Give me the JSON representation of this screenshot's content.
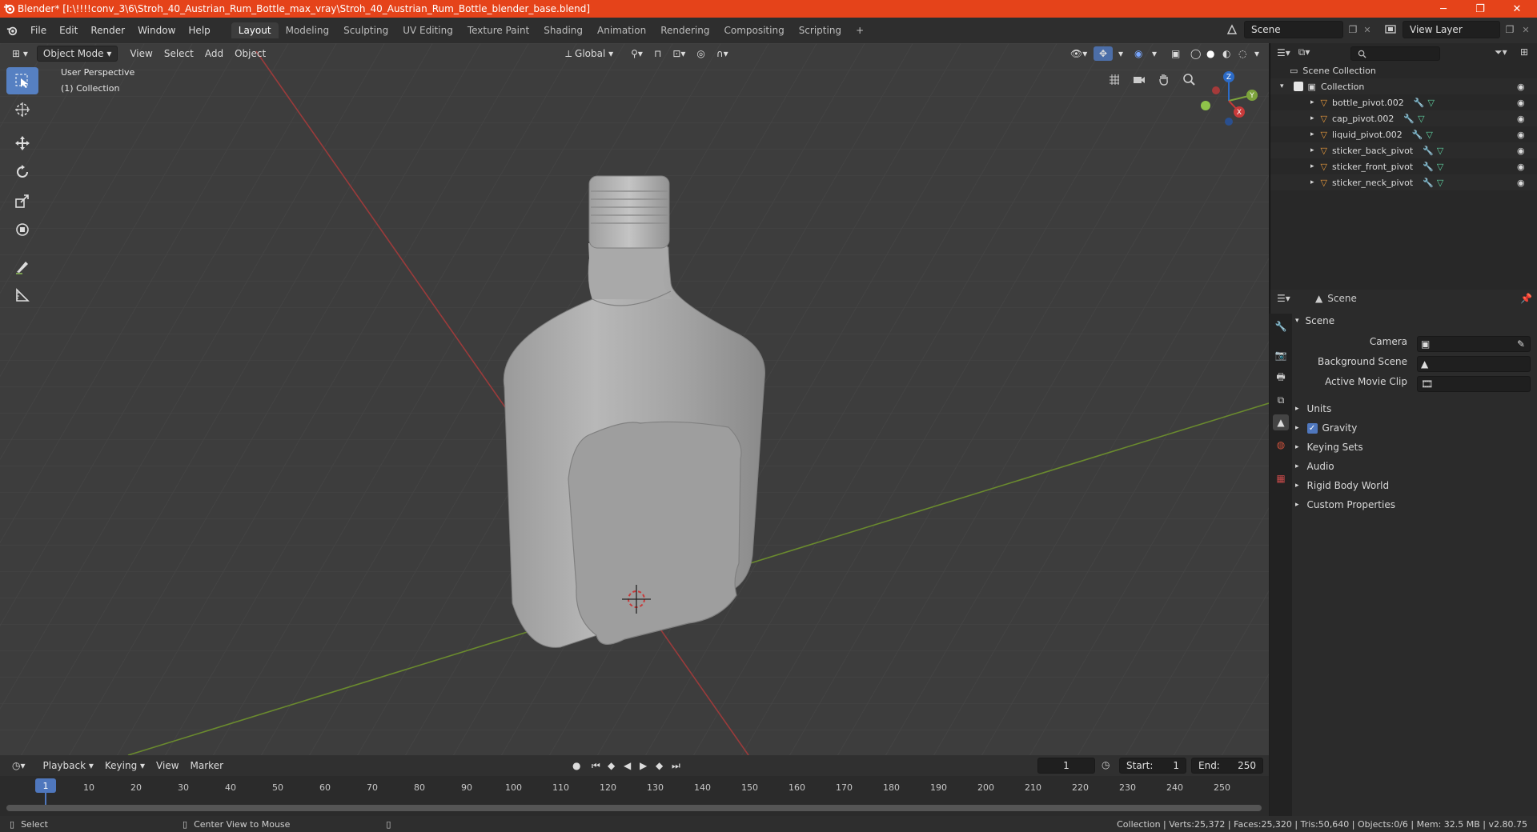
{
  "window": {
    "title": "Blender* [I:\\!!!!conv_3\\6\\Stroh_40_Austrian_Rum_Bottle_max_vray\\Stroh_40_Austrian_Rum_Bottle_blender_base.blend]",
    "controls": [
      "─",
      "❐",
      "✕"
    ]
  },
  "menubar": {
    "menus": [
      "File",
      "Edit",
      "Render",
      "Window",
      "Help"
    ],
    "workspaces": [
      "Layout",
      "Modeling",
      "Sculpting",
      "UV Editing",
      "Texture Paint",
      "Shading",
      "Animation",
      "Rendering",
      "Compositing",
      "Scripting"
    ],
    "active_workspace": "Layout",
    "add_tab": "+",
    "scene_label": "Scene",
    "view_layer_label": "View Layer"
  },
  "viewport": {
    "mode": "Object Mode",
    "menus": [
      "View",
      "Select",
      "Add",
      "Object"
    ],
    "transform_orientation": "Global",
    "overlay_text_line1": "User Perspective",
    "overlay_text_line2": "(1) Collection",
    "gizmo_axes": {
      "z": "Z",
      "y": "Y",
      "x": "X"
    },
    "colors": {
      "bg": "#3d3d3d",
      "x_axis": "#c8323c",
      "y_axis": "#82b432",
      "bottle": "#a6a6a6",
      "accent": "#5680c2"
    }
  },
  "outliner": {
    "root": "Scene Collection",
    "collection": "Collection",
    "objects": [
      "bottle_pivot.002",
      "cap_pivot.002",
      "liquid_pivot.002",
      "sticker_back_pivot",
      "sticker_front_pivot",
      "sticker_neck_pivot"
    ]
  },
  "properties": {
    "header": "Scene",
    "panel_title": "Scene",
    "fields": [
      {
        "label": "Camera",
        "value": ""
      },
      {
        "label": "Background Scene",
        "value": ""
      },
      {
        "label": "Active Movie Clip",
        "value": ""
      }
    ],
    "sections": [
      "Units",
      "Gravity",
      "Keying Sets",
      "Audio",
      "Rigid Body World",
      "Custom Properties"
    ],
    "gravity_checked": true
  },
  "timeline": {
    "menus": [
      "Playback",
      "Keying",
      "View",
      "Marker"
    ],
    "current_frame": "1",
    "start_label": "Start:",
    "start": "1",
    "end_label": "End:",
    "end": "250",
    "playhead": "1",
    "ticks": [
      "10",
      "20",
      "30",
      "40",
      "50",
      "60",
      "70",
      "80",
      "90",
      "100",
      "110",
      "120",
      "130",
      "140",
      "150",
      "160",
      "170",
      "180",
      "190",
      "200",
      "210",
      "220",
      "230",
      "240",
      "250"
    ]
  },
  "statusbar": {
    "left_action": "Select",
    "mid_action": "Center View to Mouse",
    "stats": "Collection | Verts:25,372 | Faces:25,320 | Tris:50,640 | Objects:0/6 | Mem: 32.5 MB | v2.80.75"
  }
}
